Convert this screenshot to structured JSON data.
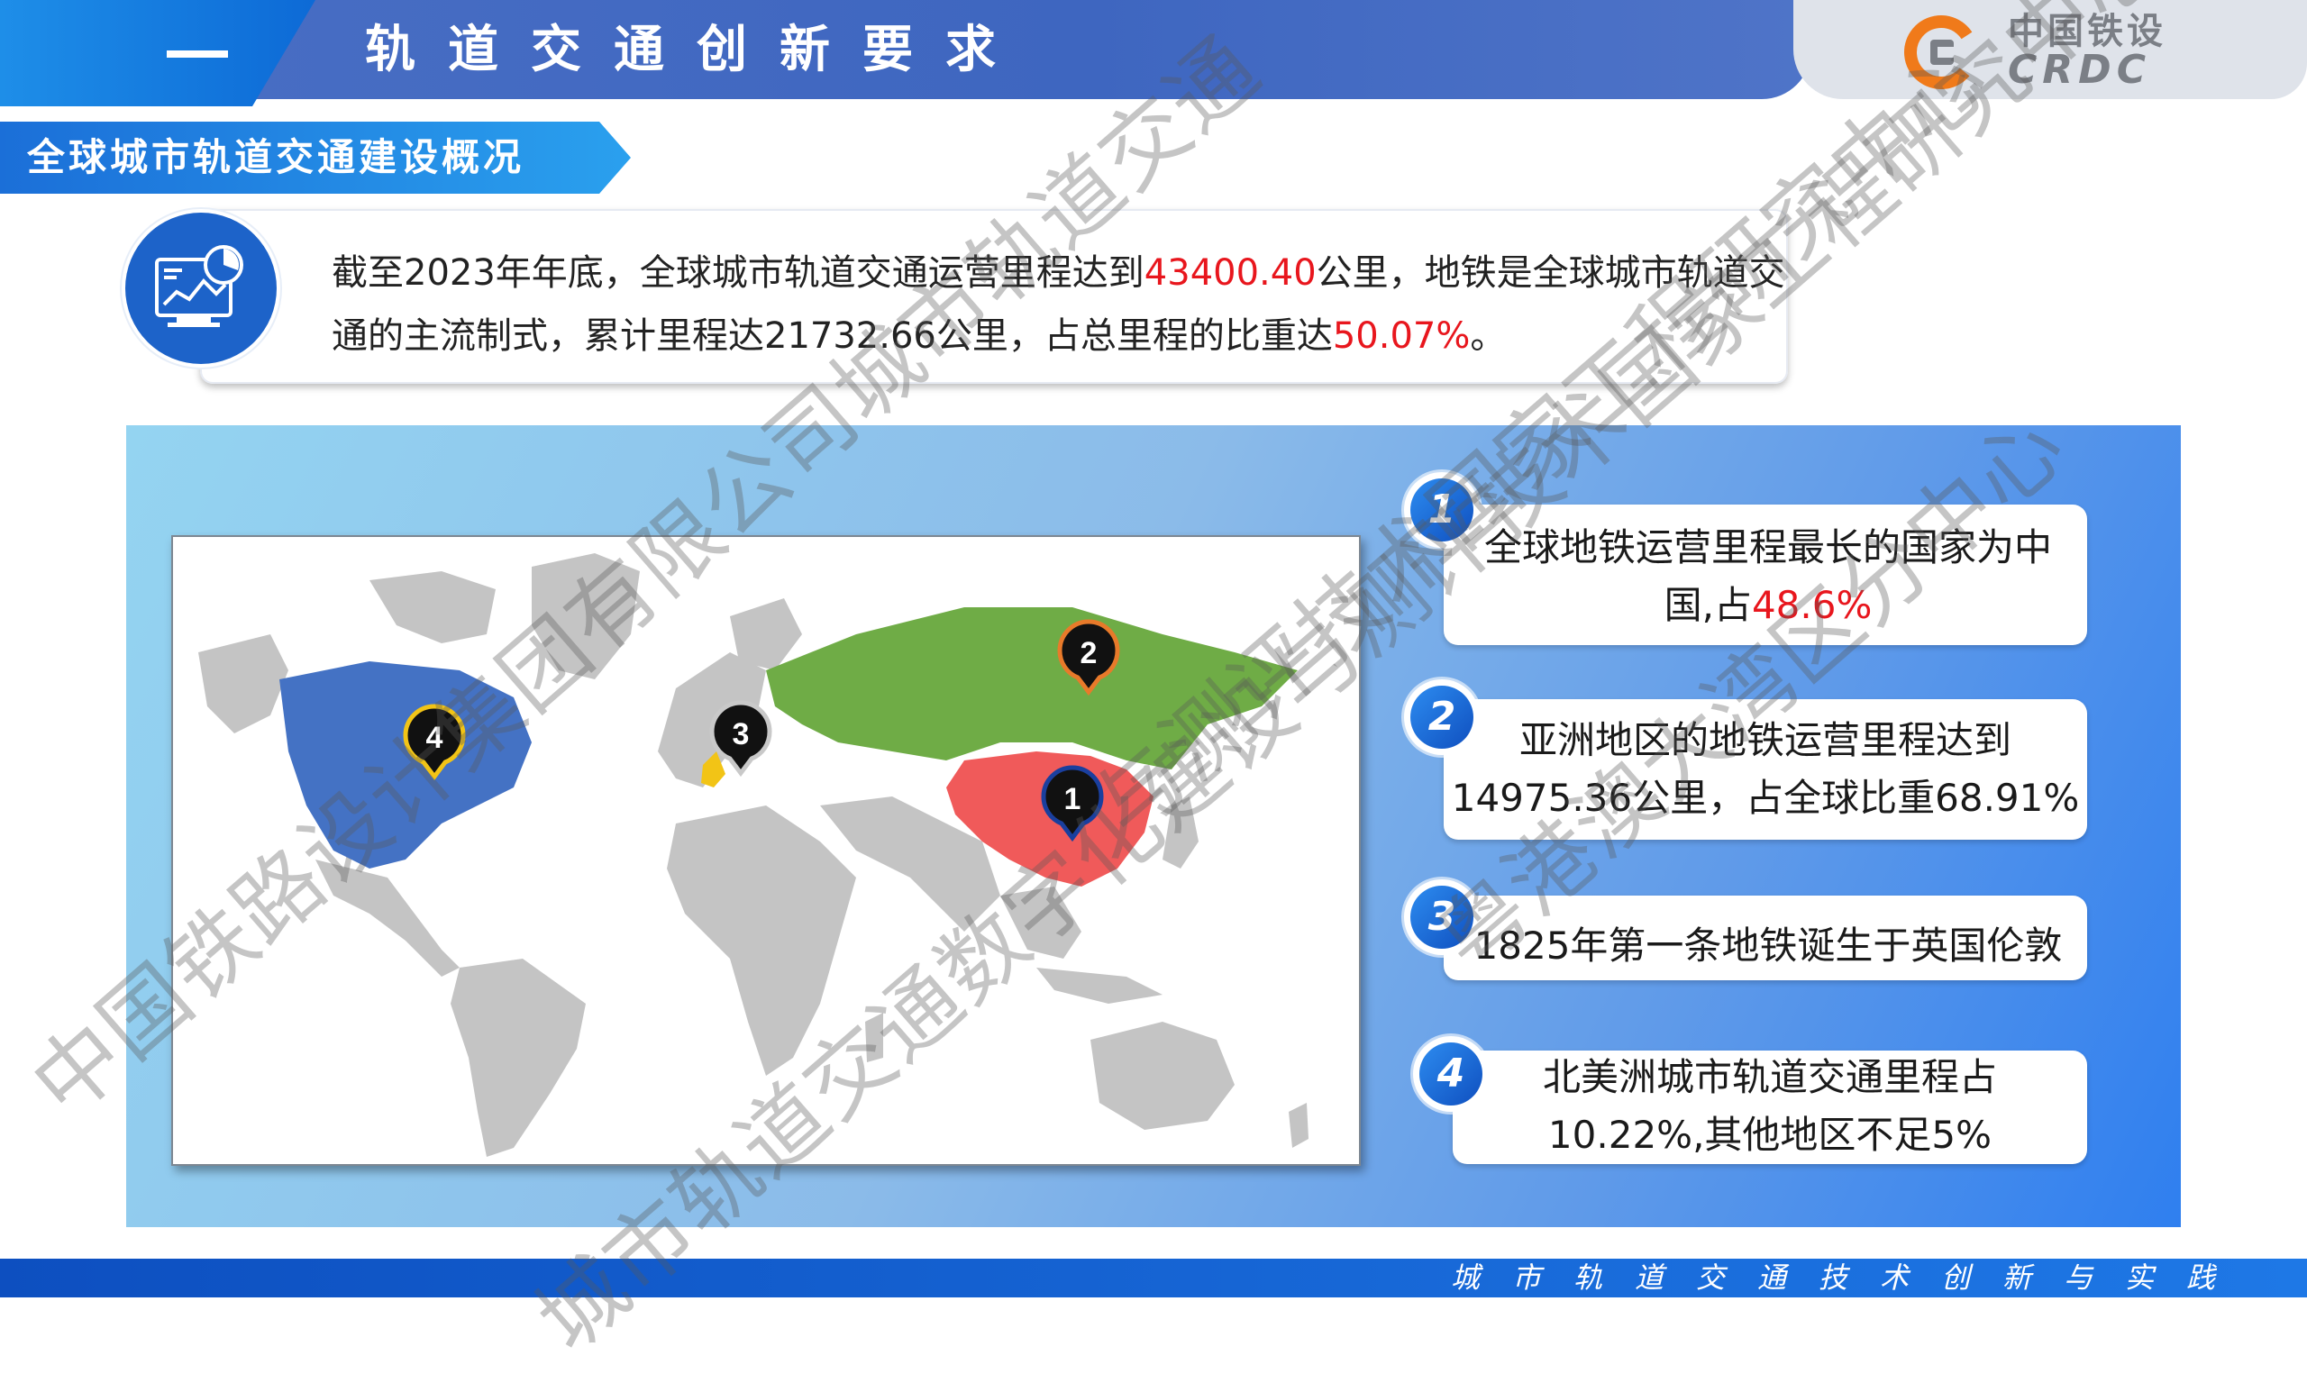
{
  "header": {
    "section_number": "一",
    "title": "轨道交通创新要求",
    "logo_cn": "中国铁设",
    "logo_en": "CRDC"
  },
  "section_tag": "全球城市轨道交通建设概况",
  "summary": {
    "part1": "截至2023年年底，全球城市轨道交通运营里程达到",
    "value1": "43400.40",
    "part2": "公里，地铁是全球城市轨道交通的主流制式，累计里程达21732.66公里，占总里程的比重达",
    "value2": "50.07%",
    "part3": "。"
  },
  "map": {
    "pins": [
      {
        "label": "1",
        "ring": "#1a3f9e"
      },
      {
        "label": "2",
        "ring": "#e87a2a"
      },
      {
        "label": "3",
        "ring": "#c9c9c9"
      },
      {
        "label": "4",
        "ring": "#f2c416"
      }
    ],
    "colors": {
      "china": "#f05a5a",
      "russia": "#6fac46",
      "north_america": "#4472c4",
      "uk": "#f2c416",
      "other": "#c4c4c4"
    }
  },
  "facts": [
    {
      "num": "1",
      "line1": "全球地铁运营里程最长的国家为中",
      "line2_a": "国,占",
      "line2_red": "48.6%"
    },
    {
      "num": "2",
      "line1": "亚洲地区的地铁运营里程达到",
      "line2": "14975.36公里，占全球比重68.91%"
    },
    {
      "num": "3",
      "line1": "1825年第一条地铁诞生于英国伦敦"
    },
    {
      "num": "4",
      "line1": "北美洲城市轨道交通里程占",
      "line2": "10.22%,其他地区不足5%"
    }
  ],
  "footer": "城市轨道交通技术创新与实践",
  "watermarks": [
    "中国铁路设计集团有限公司城市轨道交通",
    "与测评技术国家工程研究中心",
    "城市轨道交通数字化建设与测评技术国家工程研究中心",
    "粤港澳大湾区分中心"
  ]
}
